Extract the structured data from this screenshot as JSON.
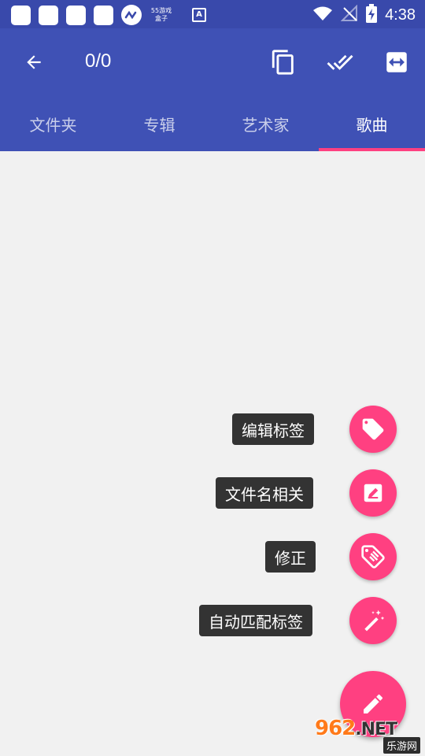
{
  "status_bar": {
    "time": "4:38",
    "icons": [
      "notification-square",
      "notification-square",
      "notification-square",
      "notification-square",
      "link-app-icon",
      "55-app-icon",
      "accessibility-a-icon",
      "wifi-icon",
      "signal-off-icon",
      "battery-charging-icon"
    ],
    "badge_55_line1": "55游戏",
    "badge_55_line2": "盒子",
    "a_icon_text": "A"
  },
  "app_bar": {
    "counter": "0/0",
    "actions": [
      "copy-icon",
      "select-all-icon",
      "swap-icon"
    ]
  },
  "tabs": [
    {
      "label": "文件夹",
      "active": false
    },
    {
      "label": "专辑",
      "active": false
    },
    {
      "label": "艺术家",
      "active": false
    },
    {
      "label": "歌曲",
      "active": true
    }
  ],
  "fab_menu": {
    "edit_tags": "编辑标签",
    "filename": "文件名相关",
    "fix": "修正",
    "auto_match": "自动匹配标签"
  },
  "colors": {
    "primary": "#3f51b5",
    "primary_dark": "#3949ab",
    "accent": "#ff4081",
    "background": "#f1f1f1"
  },
  "watermark": {
    "top": "962",
    "net": ".NET",
    "bottom": "乐游网"
  }
}
